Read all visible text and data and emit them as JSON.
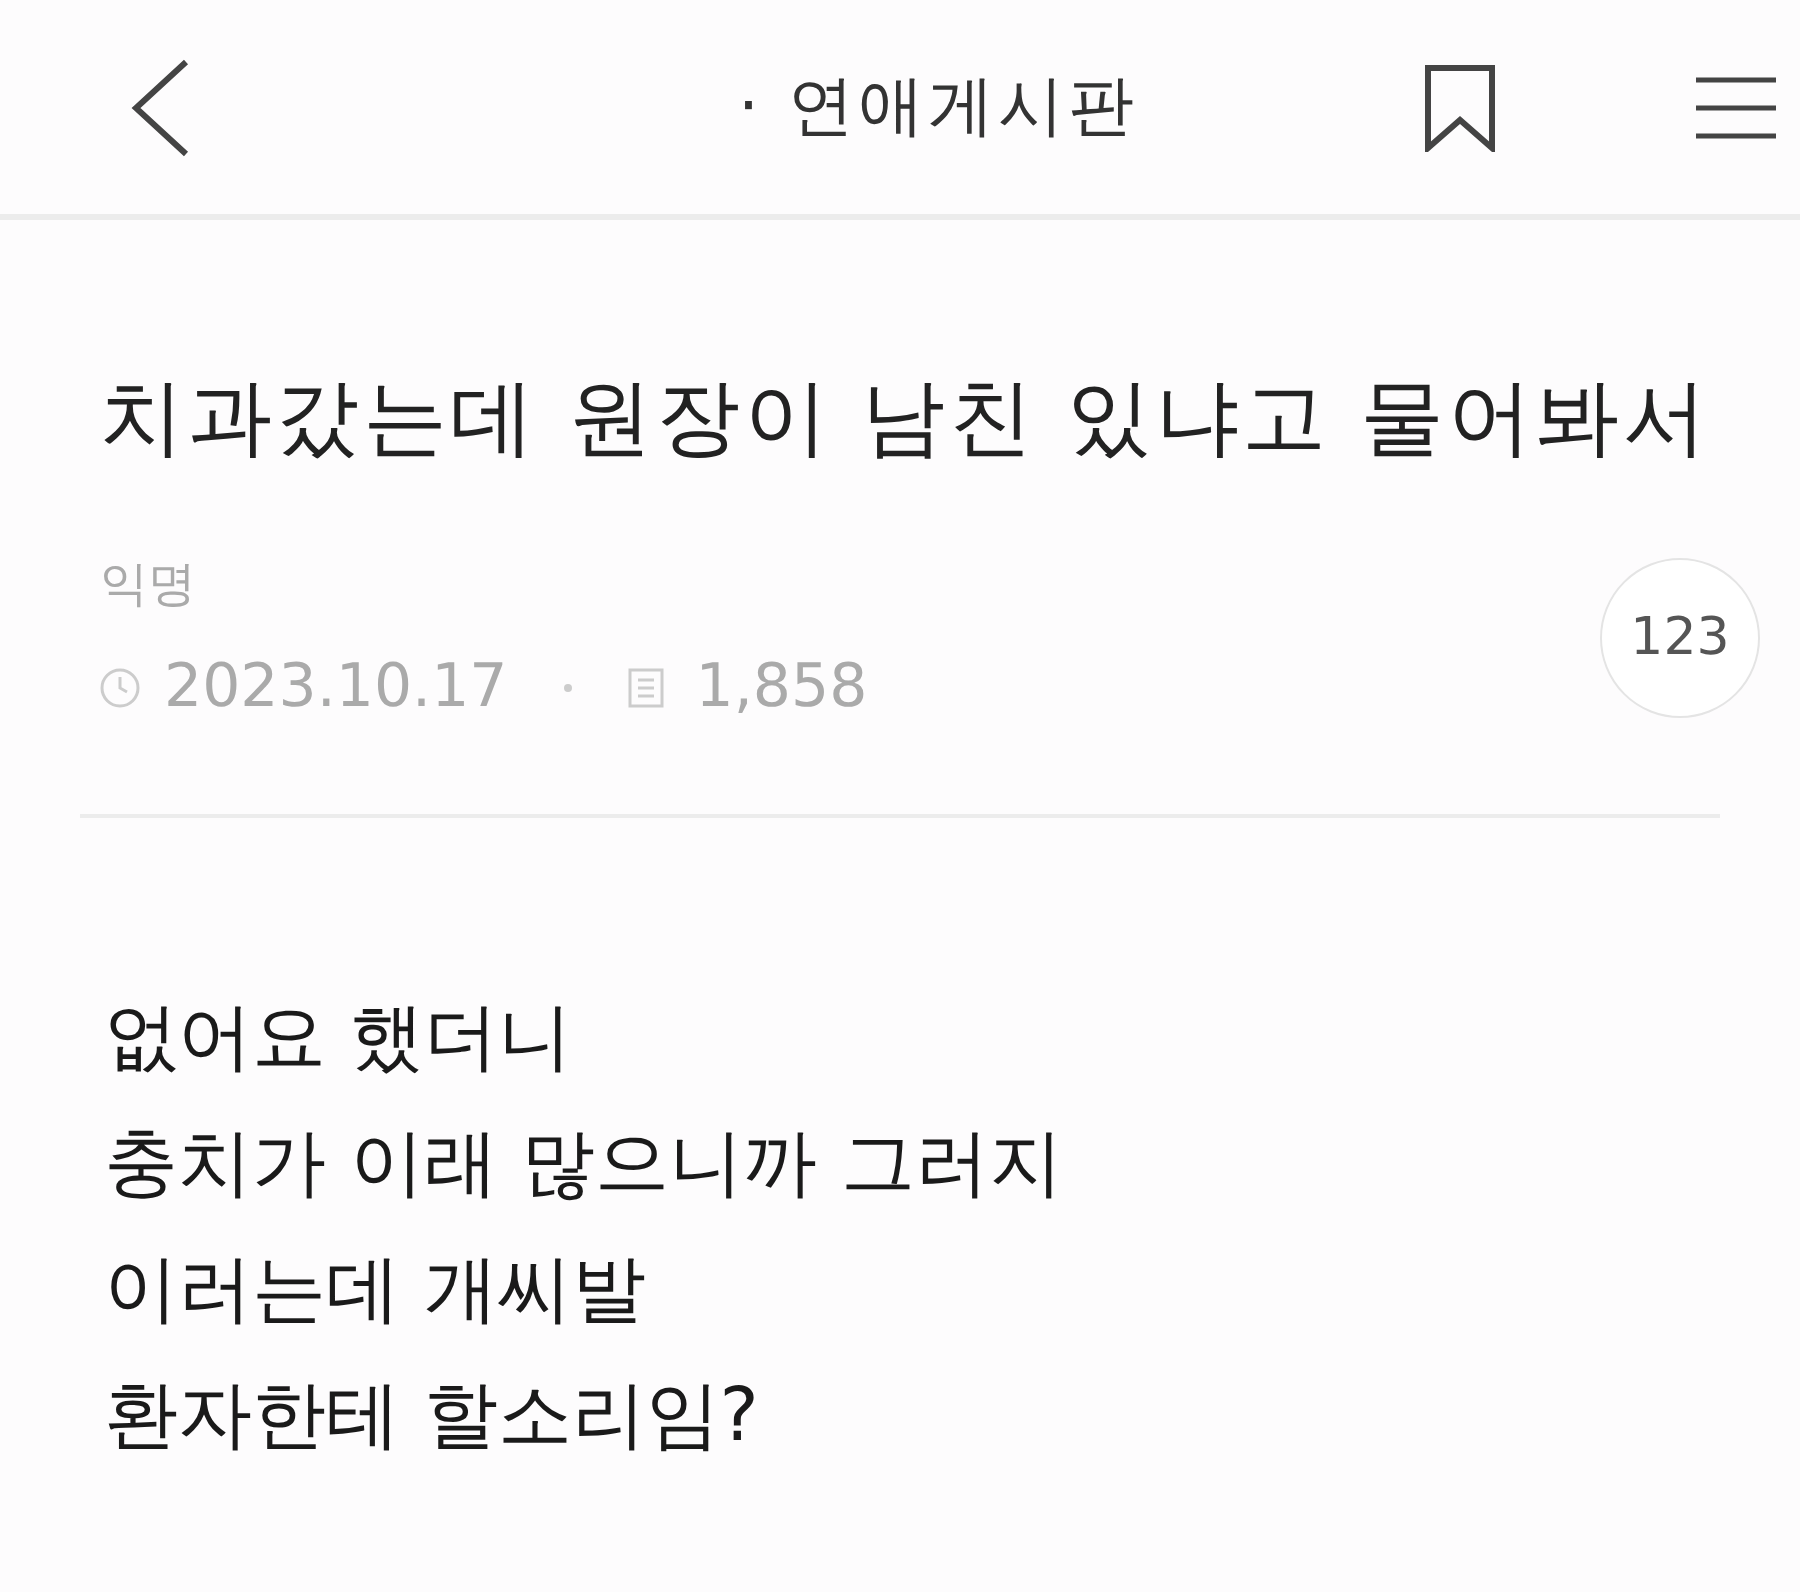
{
  "header": {
    "board": "· 연애게시판"
  },
  "post": {
    "title": "치과갔는데 원장이 남친 있냐고 물어봐서",
    "author": "익명",
    "date": "2023.10.17",
    "views": "1,858",
    "comments": "123"
  },
  "body_lines": [
    "없어요 했더니",
    "충치가 이래 많으니까 그러지",
    "이러는데 개씨발",
    "환자한테 할소리임?"
  ]
}
